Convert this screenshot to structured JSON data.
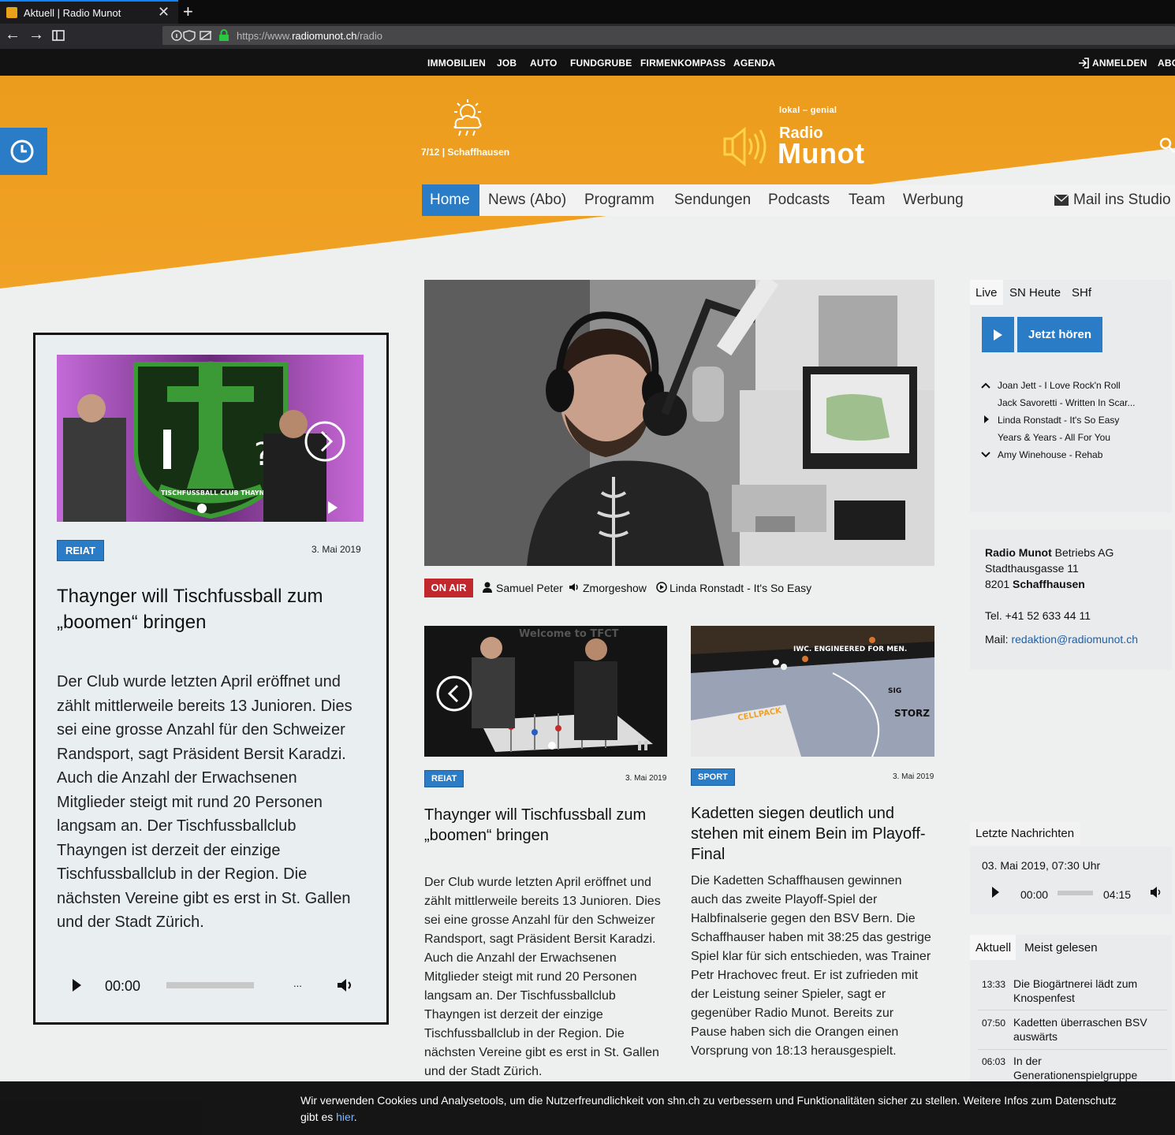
{
  "browser": {
    "tab_title": "Aktuell | Radio Munot",
    "close_glyph": "✕",
    "newtab_glyph": "+",
    "back_glyph": "←",
    "forward_glyph": "→",
    "url_prefix": "https://www.",
    "url_domain": "radiomunot.ch",
    "url_path": "/radio"
  },
  "topnav": {
    "items": [
      "IMMOBILIEN",
      "JOB",
      "AUTO",
      "FUNDGRUBE",
      "FIRMENKOMPASS",
      "AGENDA"
    ],
    "login": "ANMELDEN",
    "abo": "ABO"
  },
  "header": {
    "weather": "7/12 | Schaffhausen",
    "slogan": "lokal – genial",
    "logo_line1": "Radio",
    "logo_line2": "Munot"
  },
  "menu": {
    "items": [
      "Home",
      "News (Abo)",
      "Programm",
      "Sendungen",
      "Podcasts",
      "Team",
      "Werbung"
    ],
    "mail": "Mail ins Studio"
  },
  "featured": {
    "tag": "REIAT",
    "date": "3. Mai 2019",
    "title": "Thaynger will Tischfussball zum „boomen“ bringen",
    "text": "Der Club wurde letzten April eröffnet und zählt mittlerweile bereits 13 Junioren. Dies sei eine grosse Anzahl für den Schweizer Randsport, sagt Präsident Bersit Karadzi. Auch die Anzahl der Erwachsenen Mitglieder steigt mit rund 20 Personen langsam an. Der Tischfussballclub Thayngen ist derzeit der einzige Tischfussballclub in der Region. Die nächsten Vereine gibt es erst in St. Gallen und der Stadt Zürich.",
    "player_time": "00:00",
    "player_dots": "...",
    "image_text": "TISCHFUSSBALL CLUB THAYNGEN"
  },
  "onair": {
    "badge": "ON AIR",
    "host": "Samuel Peter",
    "show": "Zmorgeshow",
    "song": "Linda Ronstadt - It's So Easy"
  },
  "article1": {
    "tag": "REIAT",
    "date": "3. Mai 2019",
    "title": "Thaynger will Tischfussball zum „boomen“ bringen",
    "text": "Der Club wurde letzten April eröffnet und zählt mittlerweile bereits 13 Junioren. Dies sei eine grosse Anzahl für den Schweizer Randsport, sagt Präsident Bersit Karadzi. Auch die Anzahl der Erwachsenen Mitglieder steigt mit rund 20 Personen langsam an. Der Tischfussballclub Thayngen ist derzeit der einzige Tischfussballclub in der Region. Die nächsten Vereine gibt es erst in St. Gallen und der Stadt Zürich.",
    "image_text": "Welcome to TFCT"
  },
  "article2": {
    "tag": "SPORT",
    "date": "3. Mai 2019",
    "title": "Kadetten siegen deutlich und stehen mit einem Bein im Playoff-Final",
    "text": "Die Kadetten Schaffhausen gewinnen auch das zweite Playoff-Spiel der Halbfinalserie gegen den BSV Bern. Die Schaffhauser haben mit 38:25 das gestrige Spiel klar für sich entschieden, was Trainer Petr Hrachovec freut. Er ist zufrieden mit der Leistung seiner Spieler, sagt er gegenüber Radio Munot. Bereits zur Pause haben sich die Orangen einen Vorsprung von 18:13 herausgespielt.",
    "image_text_1": "IWC. ENGINEERED FOR MEN.",
    "image_text_2": "CELLPACK",
    "image_text_3": "STORZ",
    "image_text_4": "SIG"
  },
  "sidebar": {
    "tabs": [
      "Live",
      "SN Heute",
      "SHf"
    ],
    "listen": "Jetzt hören",
    "playlist": [
      "Joan Jett - I Love Rock'n Roll",
      "Jack Savoretti - Written In Scar...",
      "Linda Ronstadt - It's So Easy",
      "Years & Years - All For You",
      "Amy Winehouse - Rehab"
    ],
    "contact": {
      "company_bold": "Radio Munot",
      "company_rest": " Betriebs AG",
      "street": "Stadthausgasse 11",
      "zip": "8201 ",
      "city": "Schaffhausen",
      "tel": "Tel. +41 52 633 44 11",
      "mail_label": "Mail: ",
      "mail": "redaktion@radiomunot.ch"
    },
    "news_title": "Letzte Nachrichten",
    "news_date": "03. Mai 2019, 07:30 Uhr",
    "news_start": "00:00",
    "news_end": "04:15",
    "tabs2": [
      "Aktuell",
      "Meist gelesen"
    ],
    "news_items": [
      {
        "time": "13:33",
        "text": "Die Biogärtnerei lädt zum Knospenfest"
      },
      {
        "time": "07:50",
        "text": "Kadetten überraschen BSV auswärts"
      },
      {
        "time": "06:03",
        "text": "In der Generationenspielgruppe"
      }
    ]
  },
  "cookie": {
    "text": "Wir verwenden Cookies und Analysetools, um die Nutzerfreundlichkeit von shn.ch zu verbessern und Funktionalitäten sicher zu stellen. Weitere Infos zum Datenschutz gibt es ",
    "link": "hier",
    "end": "."
  },
  "colors": {
    "brand_orange": "#ec9c1c",
    "accent_blue": "#2a7cc7",
    "onair_red": "#c0282d"
  }
}
